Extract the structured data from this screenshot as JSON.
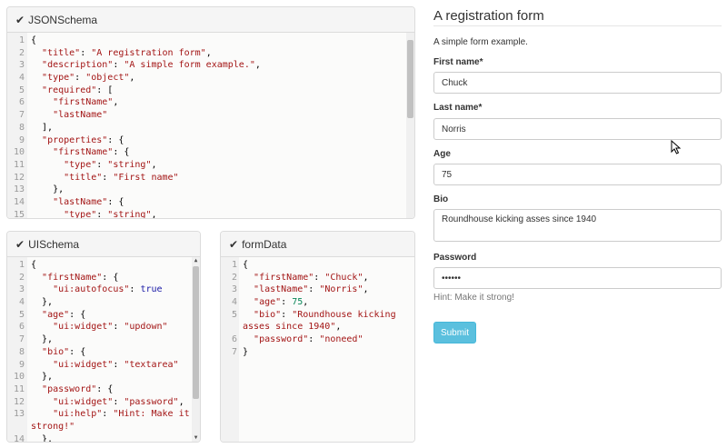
{
  "schema_panel": {
    "title": "JSONSchema",
    "lines": [
      [
        [
          "",
          "{"
        ]
      ],
      [
        [
          "",
          "  "
        ],
        [
          "str",
          "\"title\""
        ],
        [
          "",
          ": "
        ],
        [
          "str",
          "\"A registration form\""
        ],
        [
          "",
          ","
        ]
      ],
      [
        [
          "",
          "  "
        ],
        [
          "str",
          "\"description\""
        ],
        [
          "",
          ": "
        ],
        [
          "str",
          "\"A simple form example.\""
        ],
        [
          "",
          ","
        ]
      ],
      [
        [
          "",
          "  "
        ],
        [
          "str",
          "\"type\""
        ],
        [
          "",
          ": "
        ],
        [
          "str",
          "\"object\""
        ],
        [
          "",
          ","
        ]
      ],
      [
        [
          "",
          "  "
        ],
        [
          "str",
          "\"required\""
        ],
        [
          "",
          ": ["
        ]
      ],
      [
        [
          "",
          "    "
        ],
        [
          "str",
          "\"firstName\""
        ],
        [
          "",
          ","
        ]
      ],
      [
        [
          "",
          "    "
        ],
        [
          "str",
          "\"lastName\""
        ]
      ],
      [
        [
          "",
          "  ],"
        ]
      ],
      [
        [
          "",
          "  "
        ],
        [
          "str",
          "\"properties\""
        ],
        [
          "",
          ": {"
        ]
      ],
      [
        [
          "",
          "    "
        ],
        [
          "str",
          "\"firstName\""
        ],
        [
          "",
          ": {"
        ]
      ],
      [
        [
          "",
          "      "
        ],
        [
          "str",
          "\"type\""
        ],
        [
          "",
          ": "
        ],
        [
          "str",
          "\"string\""
        ],
        [
          "",
          ","
        ]
      ],
      [
        [
          "",
          "      "
        ],
        [
          "str",
          "\"title\""
        ],
        [
          "",
          ": "
        ],
        [
          "str",
          "\"First name\""
        ]
      ],
      [
        [
          "",
          "    },"
        ]
      ],
      [
        [
          "",
          "    "
        ],
        [
          "str",
          "\"lastName\""
        ],
        [
          "",
          ": {"
        ]
      ],
      [
        [
          "",
          "      "
        ],
        [
          "str",
          "\"type\""
        ],
        [
          "",
          ": "
        ],
        [
          "str",
          "\"string\""
        ],
        [
          "",
          ","
        ]
      ]
    ],
    "line_numbers": [
      "1",
      "2",
      "3",
      "4",
      "5",
      "6",
      "7",
      "8",
      "9",
      "10",
      "11",
      "12",
      "13",
      "14",
      "15"
    ]
  },
  "ui_panel": {
    "title": "UISchema",
    "lines": [
      [
        [
          "",
          "{"
        ]
      ],
      [
        [
          "",
          "  "
        ],
        [
          "str",
          "\"firstName\""
        ],
        [
          "",
          ": {"
        ]
      ],
      [
        [
          "",
          "    "
        ],
        [
          "str",
          "\"ui:autofocus\""
        ],
        [
          "",
          ": "
        ],
        [
          "bool",
          "true"
        ]
      ],
      [
        [
          "",
          "  },"
        ]
      ],
      [
        [
          "",
          "  "
        ],
        [
          "str",
          "\"age\""
        ],
        [
          "",
          ": {"
        ]
      ],
      [
        [
          "",
          "    "
        ],
        [
          "str",
          "\"ui:widget\""
        ],
        [
          "",
          ": "
        ],
        [
          "str",
          "\"updown\""
        ]
      ],
      [
        [
          "",
          "  },"
        ]
      ],
      [
        [
          "",
          "  "
        ],
        [
          "str",
          "\"bio\""
        ],
        [
          "",
          ": {"
        ]
      ],
      [
        [
          "",
          "    "
        ],
        [
          "str",
          "\"ui:widget\""
        ],
        [
          "",
          ": "
        ],
        [
          "str",
          "\"textarea\""
        ]
      ],
      [
        [
          "",
          "  },"
        ]
      ],
      [
        [
          "",
          "  "
        ],
        [
          "str",
          "\"password\""
        ],
        [
          "",
          ": {"
        ]
      ],
      [
        [
          "",
          "    "
        ],
        [
          "str",
          "\"ui:widget\""
        ],
        [
          "",
          ": "
        ],
        [
          "str",
          "\"password\""
        ],
        [
          "",
          ","
        ]
      ],
      [
        [
          "",
          "    "
        ],
        [
          "str",
          "\"ui:help\""
        ],
        [
          "",
          ": "
        ],
        [
          "str",
          "\"Hint: Make it"
        ]
      ],
      [
        [
          "str",
          "strong!\""
        ]
      ],
      [
        [
          "",
          "  },"
        ]
      ]
    ],
    "line_numbers": [
      "1",
      "2",
      "3",
      "4",
      "5",
      "6",
      "7",
      "8",
      "9",
      "10",
      "11",
      "12",
      "13",
      "",
      "14"
    ]
  },
  "form_data_panel": {
    "title": "formData",
    "lines": [
      [
        [
          "",
          "{"
        ]
      ],
      [
        [
          "",
          "  "
        ],
        [
          "str",
          "\"firstName\""
        ],
        [
          "",
          ": "
        ],
        [
          "str",
          "\"Chuck\""
        ],
        [
          "",
          ","
        ]
      ],
      [
        [
          "",
          "  "
        ],
        [
          "str",
          "\"lastName\""
        ],
        [
          "",
          ": "
        ],
        [
          "str",
          "\"Norris\""
        ],
        [
          "",
          ","
        ]
      ],
      [
        [
          "",
          "  "
        ],
        [
          "str",
          "\"age\""
        ],
        [
          "",
          ": "
        ],
        [
          "num",
          "75"
        ],
        [
          "",
          ","
        ]
      ],
      [
        [
          "",
          "  "
        ],
        [
          "str",
          "\"bio\""
        ],
        [
          "",
          ": "
        ],
        [
          "str",
          "\"Roundhouse kicking"
        ]
      ],
      [
        [
          "str",
          "asses since 1940\""
        ],
        [
          "",
          ","
        ]
      ],
      [
        [
          "",
          "  "
        ],
        [
          "str",
          "\"password\""
        ],
        [
          "",
          ": "
        ],
        [
          "str",
          "\"noneed\""
        ]
      ],
      [
        [
          "",
          "}"
        ]
      ]
    ],
    "line_numbers": [
      "1",
      "2",
      "3",
      "4",
      "5",
      "",
      "6",
      "7"
    ]
  },
  "form": {
    "title": "A registration form",
    "description": "A simple form example.",
    "first_name_label": "First name*",
    "first_name_value": "Chuck",
    "last_name_label": "Last name*",
    "last_name_value": "Norris",
    "age_label": "Age",
    "age_value": "75",
    "bio_label": "Bio",
    "bio_value": "Roundhouse kicking asses since 1940",
    "password_label": "Password",
    "password_value": "••••••",
    "password_hint": "Hint: Make it strong!",
    "submit_label": "Submit"
  },
  "icons": {
    "panel_check": "check-icon",
    "mouse_cursor": "cursor-icon"
  },
  "colors": {
    "submit_button": "#5bc0de",
    "string_token": "#a31515",
    "boolean_token": "#1a1aa6",
    "number_token": "#098658"
  }
}
